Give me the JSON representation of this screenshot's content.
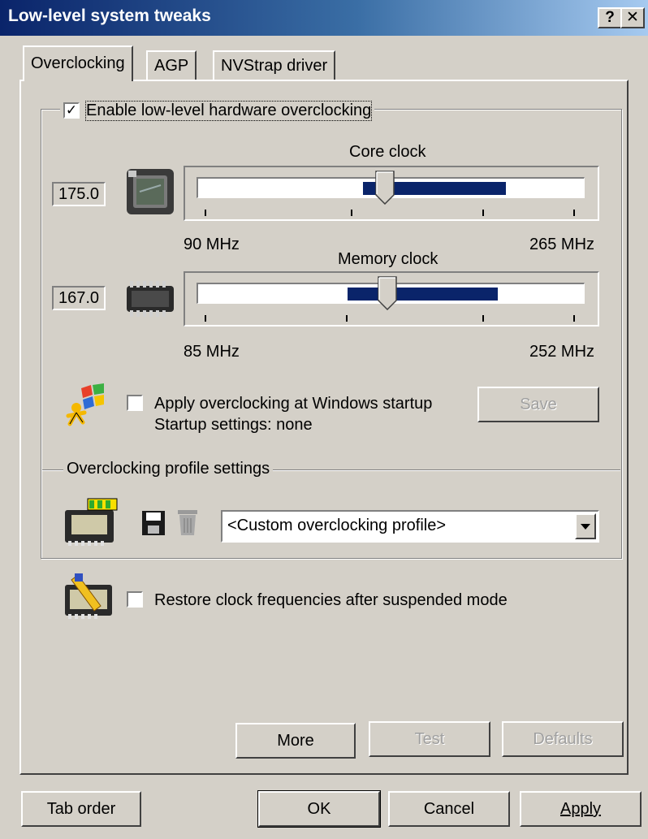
{
  "window": {
    "title": "Low-level system tweaks",
    "help_label": "?",
    "close_label": "✕"
  },
  "tabs": [
    {
      "label": "Overclocking",
      "active": true
    },
    {
      "label": "AGP",
      "active": false
    },
    {
      "label": "NVStrap driver",
      "active": false
    }
  ],
  "overclocking": {
    "enable_label": "Enable low-level hardware overclocking",
    "enable_checked": true,
    "core": {
      "title": "Core clock",
      "value": "175.0",
      "min_label": "90 MHz",
      "max_label": "265 MHz",
      "min": 90,
      "max": 265,
      "current": 175.0,
      "range_low": 165,
      "range_high": 230,
      "icon": "gpu-chip-icon"
    },
    "memory": {
      "title": "Memory clock",
      "value": "167.0",
      "min_label": "85 MHz",
      "max_label": "252 MHz",
      "min": 85,
      "max": 252,
      "current": 167.0,
      "range_low": 150,
      "range_high": 215,
      "icon": "memory-chip-icon"
    },
    "startup": {
      "label": "Apply overclocking at Windows startup",
      "checked": false,
      "status": "Startup settings: none",
      "save_label": "Save",
      "icon": "windows-startup-icon"
    },
    "profile": {
      "group_label": "Overclocking profile settings",
      "selected": "<Custom overclocking profile>",
      "icons": [
        "video-card-icon",
        "floppy-save-icon",
        "trash-icon"
      ]
    },
    "restore": {
      "label": "Restore clock frequencies after suspended mode",
      "checked": false,
      "icon": "restore-card-icon"
    },
    "buttons": {
      "more": "More",
      "test": "Test",
      "defaults": "Defaults"
    }
  },
  "footer": {
    "tab_order": "Tab order",
    "ok": "OK",
    "cancel": "Cancel",
    "apply": "Apply"
  },
  "colors": {
    "titlebar_start": "#0a246a",
    "titlebar_end": "#a6caf0",
    "face": "#d4d0c8",
    "range": "#0a246a"
  }
}
